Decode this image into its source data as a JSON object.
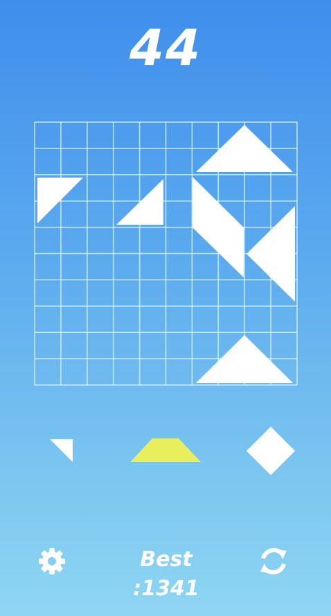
{
  "score": "44",
  "best": {
    "label": "Best :",
    "value": "1341"
  },
  "board": {
    "columns": 10,
    "rows": 10,
    "grid_line_color": "#e6f2ff",
    "placed_piece_color": "#ffffff",
    "placed_pieces": [
      {
        "name": "top-right-triangle"
      },
      {
        "name": "left-small-triangle"
      },
      {
        "name": "center-right-triangle"
      },
      {
        "name": "parallelogram-piece"
      },
      {
        "name": "left-pointing-triangle"
      },
      {
        "name": "bottom-triangle"
      }
    ]
  },
  "tray": {
    "pieces": [
      {
        "name": "small-triangle",
        "color": "#ffffff",
        "selected": false
      },
      {
        "name": "trapezoid",
        "color": "#e8ee5c",
        "selected": true
      },
      {
        "name": "diamond",
        "color": "#ffffff",
        "selected": false
      }
    ]
  },
  "controls": {
    "settings_icon": "gear-icon",
    "restart_icon": "refresh-icon"
  }
}
